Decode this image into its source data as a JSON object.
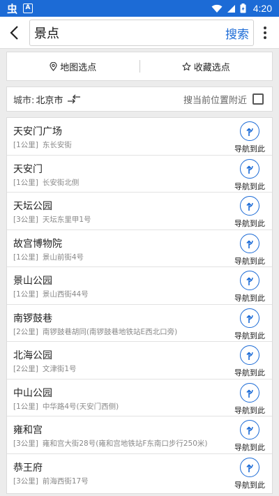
{
  "status_bar": {
    "app_glyph": "虫",
    "badge": "A",
    "time": "4:20"
  },
  "search": {
    "query": "景点",
    "search_label": "搜索"
  },
  "modes": {
    "map_pick": "地图选点",
    "favorite_pick": "收藏选点"
  },
  "city": {
    "label": "城市:",
    "value": "北京市",
    "nearby_label": "搜当前位置附近"
  },
  "results": [
    {
      "name": "天安门广场",
      "distance": "[1公里]",
      "address": "东长安街",
      "nav_label": "导航到此"
    },
    {
      "name": "天安门",
      "distance": "[1公里]",
      "address": "长安街北侧",
      "nav_label": "导航到此"
    },
    {
      "name": "天坛公园",
      "distance": "[3公里]",
      "address": "天坛东里甲1号",
      "nav_label": "导航到此"
    },
    {
      "name": "故宫博物院",
      "distance": "[1公里]",
      "address": "景山前街4号",
      "nav_label": "导航到此"
    },
    {
      "name": "景山公园",
      "distance": "[1公里]",
      "address": "景山西街44号",
      "nav_label": "导航到此"
    },
    {
      "name": "南锣鼓巷",
      "distance": "[2公里]",
      "address": "南锣鼓巷胡同(南锣鼓巷地铁站E西北口旁)",
      "nav_label": "导航到此"
    },
    {
      "name": "北海公园",
      "distance": "[2公里]",
      "address": "文津街1号",
      "nav_label": "导航到此"
    },
    {
      "name": "中山公园",
      "distance": "[1公里]",
      "address": "中华路4号(天安门西侧)",
      "nav_label": "导航到此"
    },
    {
      "name": "雍和宫",
      "distance": "[3公里]",
      "address": "雍和宫大街28号(雍和宫地铁站F东南口步行250米)",
      "nav_label": "导航到此"
    },
    {
      "name": "恭王府",
      "distance": "[3公里]",
      "address": "前海西街17号",
      "nav_label": "导航到此"
    }
  ],
  "colors": {
    "accent": "#1c6bd6",
    "status_bar": "#1c6bd6"
  },
  "icons": {
    "back": "back-arrow-icon",
    "more": "more-vertical-icon",
    "map_pick": "location-pin-icon",
    "favorite": "star-outline-icon",
    "switch_city": "switch-arrows-icon",
    "navigate": "navigation-turn-icon"
  }
}
